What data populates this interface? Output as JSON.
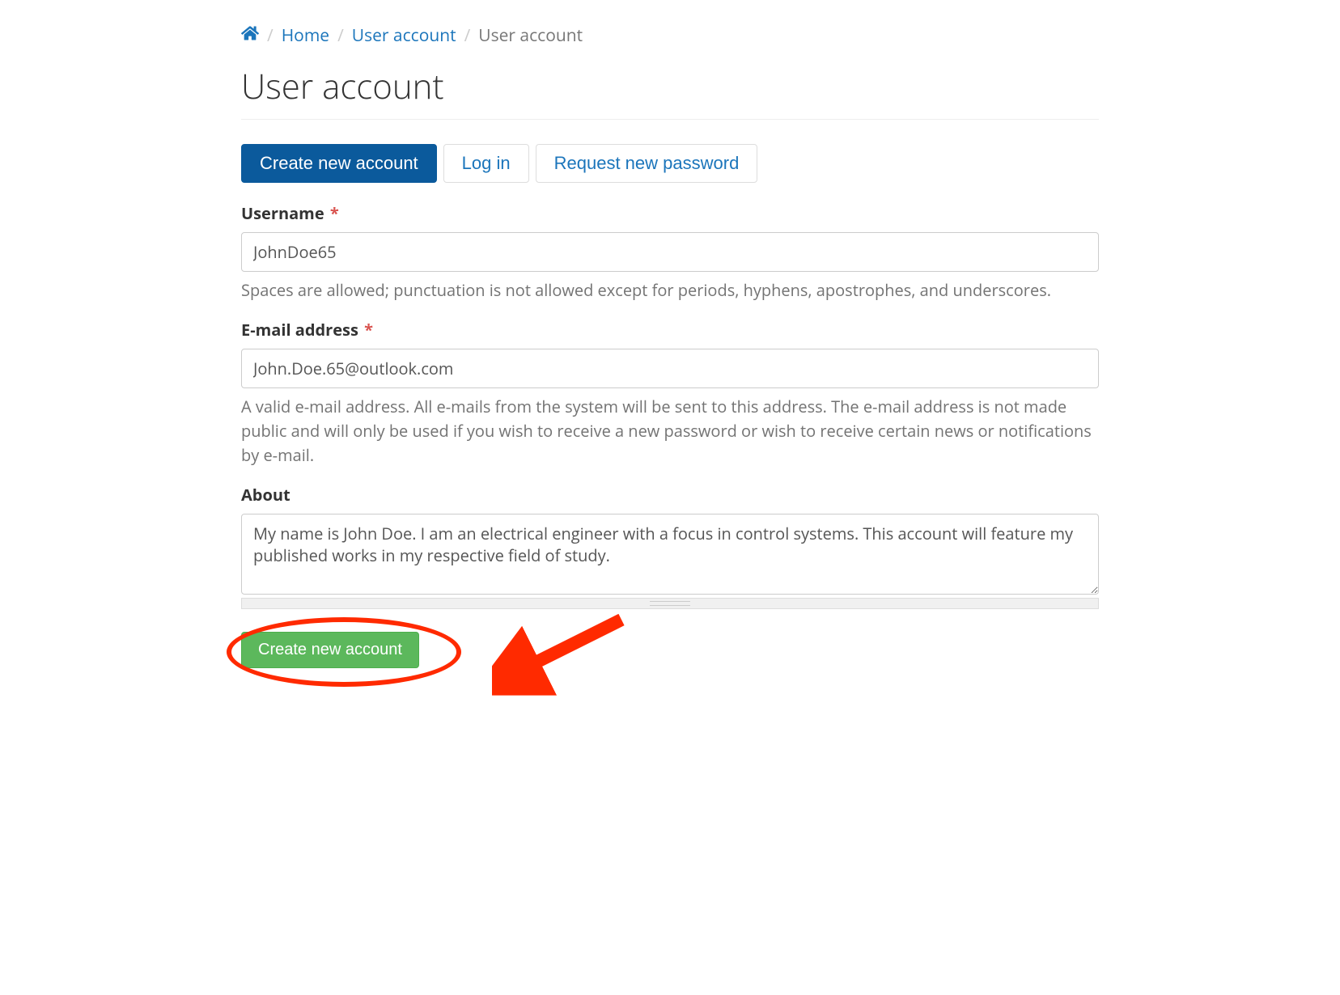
{
  "breadcrumb": {
    "home": "Home",
    "user_account_link": "User account",
    "current": "User account"
  },
  "page_title": "User account",
  "tabs": {
    "create": "Create new account",
    "login": "Log in",
    "request": "Request new password"
  },
  "form": {
    "username": {
      "label": "Username",
      "value": "JohnDoe65",
      "help": "Spaces are allowed; punctuation is not allowed except for periods, hyphens, apostrophes, and underscores."
    },
    "email": {
      "label": "E-mail address",
      "value": "John.Doe.65@outlook.com",
      "help": "A valid e-mail address. All e-mails from the system will be sent to this address. The e-mail address is not made public and will only be used if you wish to receive a new password or wish to receive certain news or notifications by e-mail."
    },
    "about": {
      "label": "About",
      "value": "My name is John Doe. I am an electrical engineer with a focus in control systems. This account will feature my published works in my respective field of study."
    },
    "submit_label": "Create new account"
  },
  "required_marker": "*"
}
